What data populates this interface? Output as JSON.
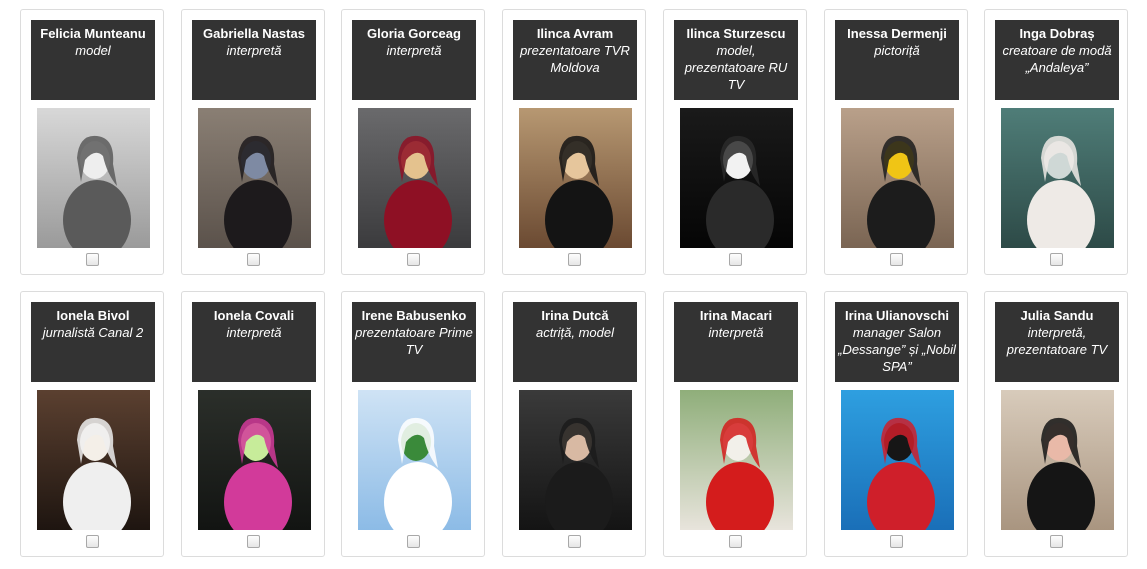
{
  "profiles": [
    {
      "name": "Felicia Munteanu",
      "role": "model",
      "photo": "photo-woman-bw",
      "bg": [
        "#d8d8d8",
        "#9a9a9a"
      ],
      "figure": "#5a5a5a",
      "accent": "#eeeeee"
    },
    {
      "name": "Gabriella Nastas",
      "role": "interpretă",
      "photo": "photo-woman-stairs",
      "bg": [
        "#8a7f74",
        "#5b524b"
      ],
      "figure": "#1d1a1c",
      "accent": "#7e8aa3"
    },
    {
      "name": "Gloria Gorceag",
      "role": "interpretă",
      "photo": "photo-woman-red-dress",
      "bg": [
        "#6a6a6c",
        "#3b3b3d"
      ],
      "figure": "#8e1024",
      "accent": "#e4c28e"
    },
    {
      "name": "Ilinca Avram",
      "role": "prezentatoare TVR Moldova",
      "photo": "photo-woman-portrait",
      "bg": [
        "#b79872",
        "#6b4a32"
      ],
      "figure": "#141414",
      "accent": "#e6c69c"
    },
    {
      "name": "Ilinca Sturzescu",
      "role": "model, prezentatoare RU TV",
      "photo": "photo-woman-fashiontv",
      "bg": [
        "#1a1a1a",
        "#050505"
      ],
      "figure": "#2a2a2a",
      "accent": "#f2f2f2"
    },
    {
      "name": "Inessa Dermenji",
      "role": "pictoriță",
      "photo": "photo-woman-motorcycle",
      "bg": [
        "#b9a08a",
        "#7a6553"
      ],
      "figure": "#1c1c1c",
      "accent": "#f0c515"
    },
    {
      "name": "Inga Dobraș",
      "role": "creatoare de modă „Andaleya”",
      "photo": "photo-woman-chair",
      "bg": [
        "#4f7d78",
        "#2d4a47"
      ],
      "figure": "#eeeae6",
      "accent": "#cfd8d6"
    },
    {
      "name": "Ionela Bivol",
      "role": "jurnalistă Canal 2",
      "photo": "photo-woman-bed-newspaper",
      "bg": [
        "#5b4030",
        "#1e1510"
      ],
      "figure": "#efefef",
      "accent": "#f4efe8"
    },
    {
      "name": "Ionela Covali",
      "role": "interpretă",
      "photo": "photo-woman-car",
      "bg": [
        "#2b2f2a",
        "#121412"
      ],
      "figure": "#d23a9a",
      "accent": "#c7ec9a"
    },
    {
      "name": "Irene Babusenko",
      "role": "prezentatoare Prime TV",
      "photo": "photo-woman-bride",
      "bg": [
        "#cfe3f5",
        "#8cbbe6"
      ],
      "figure": "#ffffff",
      "accent": "#3a8a3a"
    },
    {
      "name": "Irina Dutcă",
      "role": "actriță, model",
      "photo": "photo-woman-closeup",
      "bg": [
        "#3a3a3a",
        "#141414"
      ],
      "figure": "#1b1b1b",
      "accent": "#d8b9a3"
    },
    {
      "name": "Irina Macari",
      "role": "interpretă",
      "photo": "photo-woman-red-balcony",
      "bg": [
        "#8fae7a",
        "#e8e4dc"
      ],
      "figure": "#d41c1c",
      "accent": "#f2f0ea"
    },
    {
      "name": "Irina Ulianovschi",
      "role": "manager Salon „Dessange” și „Nobil SPA”",
      "photo": "photo-woman-red-blazer",
      "bg": [
        "#2e9fe0",
        "#1a6fb8"
      ],
      "figure": "#cf1f2a",
      "accent": "#161616"
    },
    {
      "name": "Julia Sandu",
      "role": "interpretă, prezentatoare TV",
      "photo": "photo-woman-shop",
      "bg": [
        "#d8cbbb",
        "#a99580"
      ],
      "figure": "#151515",
      "accent": "#e9b9a8"
    }
  ]
}
